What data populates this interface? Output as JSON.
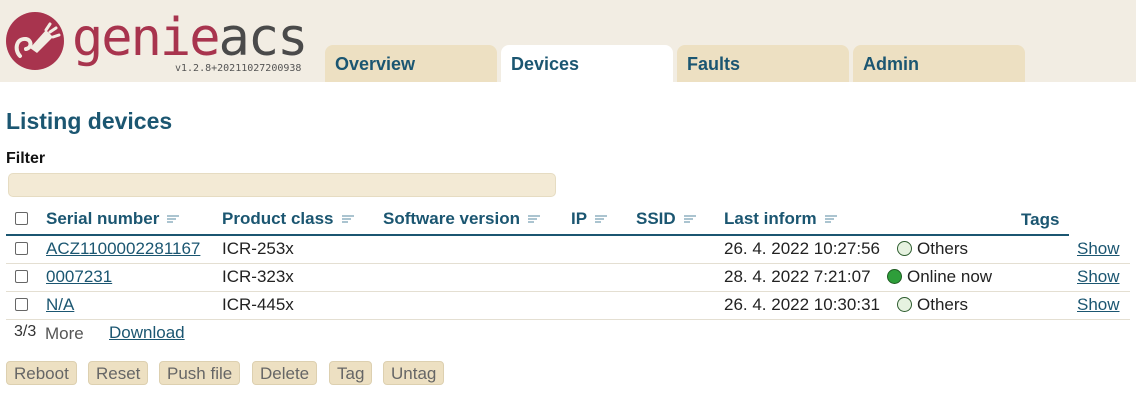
{
  "header": {
    "logo_genie": "genie",
    "logo_acs": "acs",
    "version": "v1.2.8+20211027200938",
    "tabs": [
      {
        "label": "Overview",
        "active": false
      },
      {
        "label": "Devices",
        "active": true
      },
      {
        "label": "Faults",
        "active": false
      },
      {
        "label": "Admin",
        "active": false
      }
    ]
  },
  "main": {
    "title": "Listing devices",
    "filter_label": "Filter",
    "filter_value": ""
  },
  "table": {
    "columns": [
      "Serial number",
      "Product class",
      "Software version",
      "IP",
      "SSID",
      "Last inform",
      "Tags"
    ],
    "rows": [
      {
        "serial": "ACZ1100002281167",
        "product_class": "ICR-253x",
        "software_version": "",
        "ip": "",
        "ssid": "",
        "last_inform": "26. 4. 2022 10:27:56",
        "status": "Others",
        "status_color": "#e6f2e0",
        "action": "Show"
      },
      {
        "serial": "0007231",
        "product_class": "ICR-323x",
        "software_version": "",
        "ip": "",
        "ssid": "",
        "last_inform": "28. 4. 2022 7:21:07",
        "status": "Online now",
        "status_color": "#2e9e3a",
        "action": "Show"
      },
      {
        "serial": "N/A",
        "product_class": "ICR-445x",
        "software_version": "",
        "ip": "",
        "ssid": "",
        "last_inform": "26. 4. 2022 10:30:31",
        "status": "Others",
        "status_color": "#e6f2e0",
        "action": "Show"
      }
    ]
  },
  "footer": {
    "count": "3/3",
    "more": "More",
    "download": "Download"
  },
  "actions": [
    "Reboot",
    "Reset",
    "Push file",
    "Delete",
    "Tag",
    "Untag"
  ],
  "colors": {
    "brand": "#a8344e",
    "accent": "#1b5671",
    "header_bg": "#f2ede3",
    "tab_bg": "#ede0c2"
  }
}
